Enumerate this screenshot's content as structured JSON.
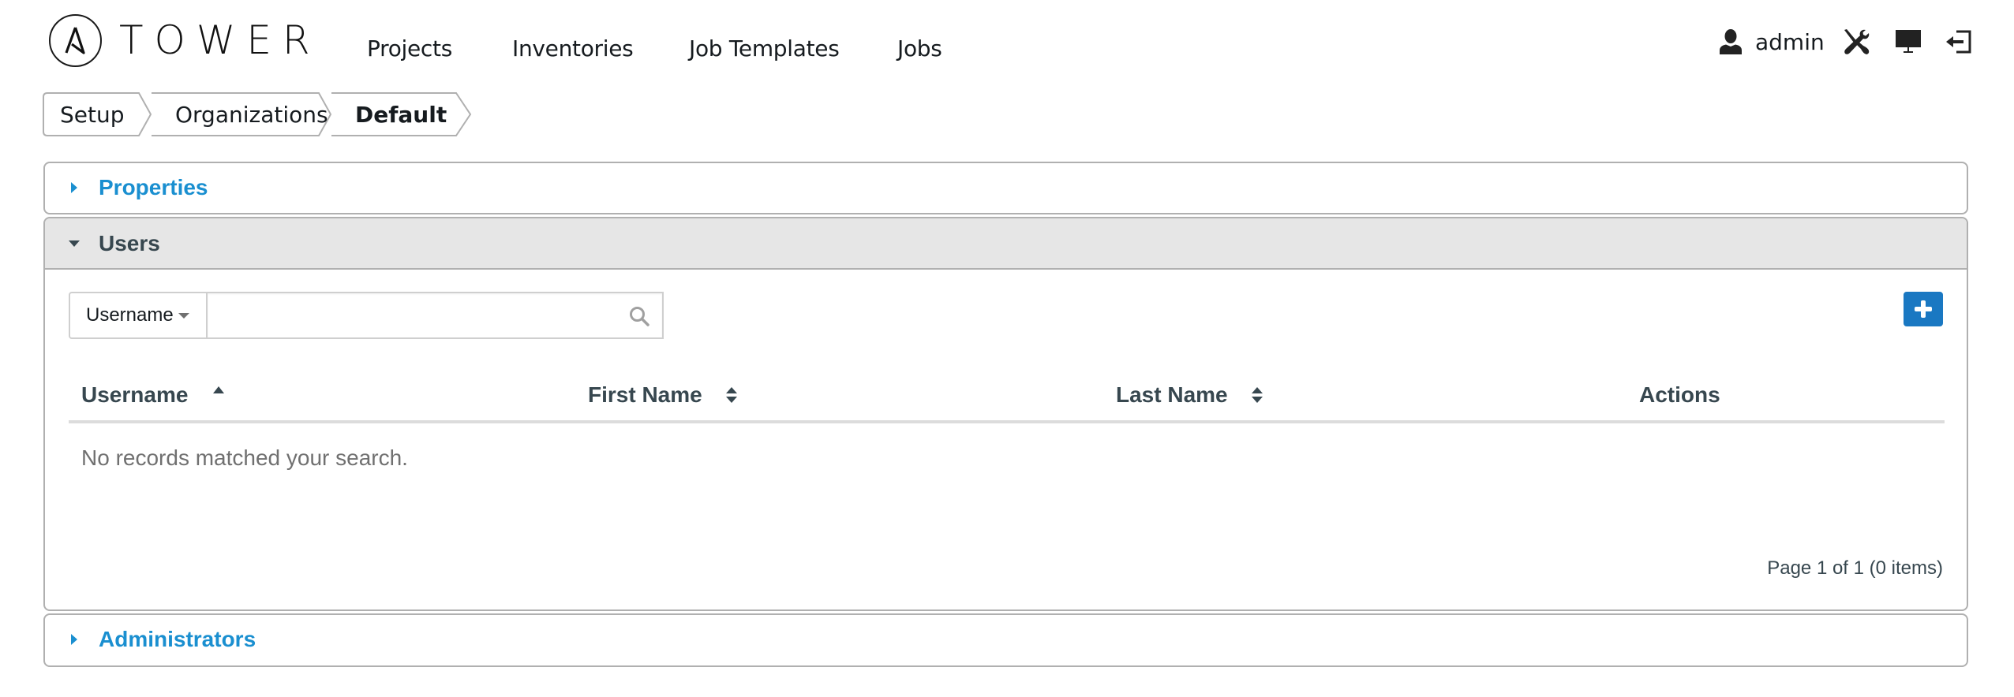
{
  "header": {
    "logo_text": "TOWER",
    "nav": [
      {
        "label": "Projects"
      },
      {
        "label": "Inventories"
      },
      {
        "label": "Job Templates"
      },
      {
        "label": "Jobs"
      }
    ],
    "user": {
      "username": "admin",
      "icons": [
        "user-icon",
        "tools-icon",
        "monitor-icon",
        "logout-icon"
      ]
    }
  },
  "breadcrumb": [
    {
      "label": "Setup"
    },
    {
      "label": "Organizations"
    },
    {
      "label": "Default",
      "active": true
    }
  ],
  "panels": {
    "properties": {
      "title": "Properties",
      "expanded": false
    },
    "users": {
      "title": "Users",
      "expanded": true,
      "search": {
        "field": "Username",
        "value": "",
        "placeholder": ""
      },
      "add_button_icon": "plus-icon",
      "table": {
        "columns": [
          {
            "label": "Username",
            "sort": "ascending"
          },
          {
            "label": "First Name",
            "sort": "sortable"
          },
          {
            "label": "Last Name",
            "sort": "sortable"
          },
          {
            "label": "Actions",
            "sort": "none"
          }
        ],
        "rows": [],
        "empty_message": "No records matched your search."
      },
      "pagination": "Page 1 of 1 (0 items)"
    },
    "administrators": {
      "title": "Administrators",
      "expanded": false
    }
  },
  "colors": {
    "link_blue": "#1a8fd0",
    "button_blue": "#1a78c2",
    "header_text": "#37474f",
    "panel_border": "#b0b0b0",
    "panel_header_bg": "#e6e6e6"
  }
}
